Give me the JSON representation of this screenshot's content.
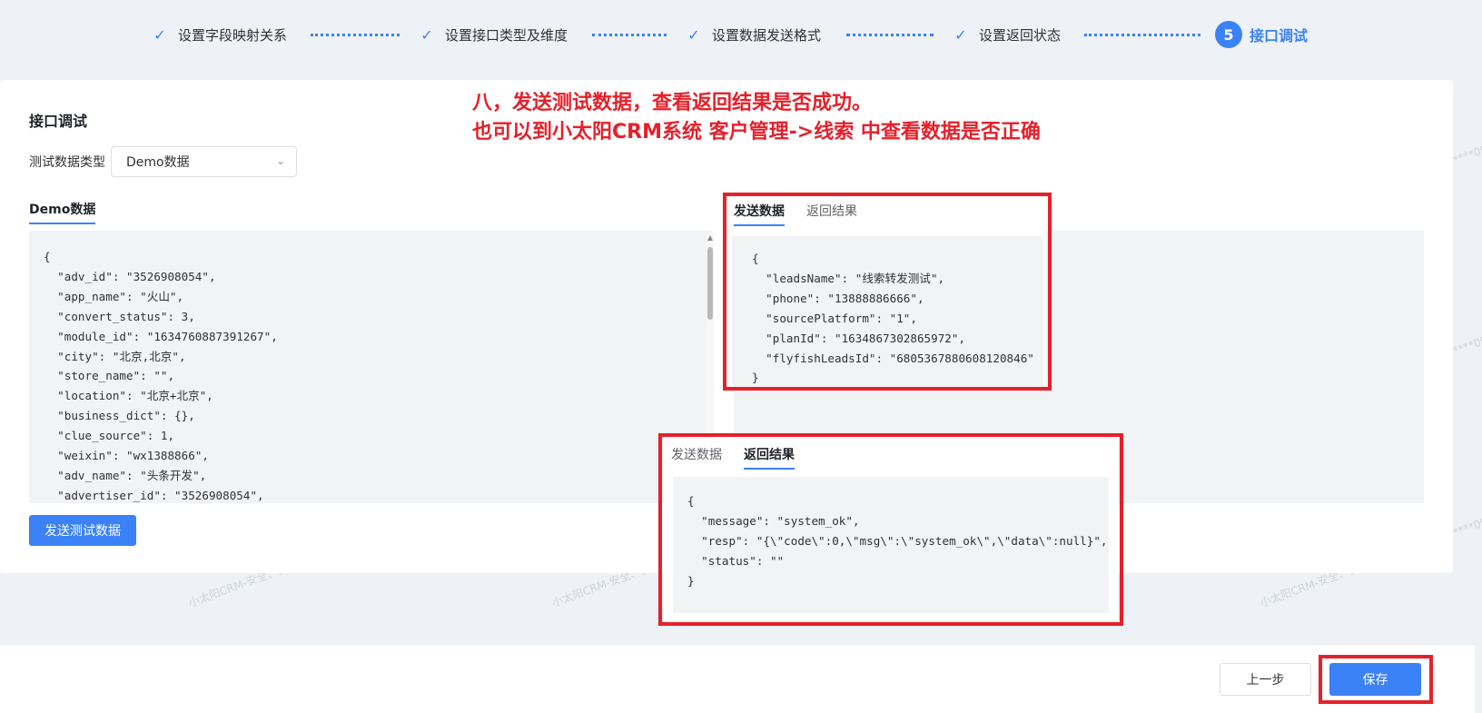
{
  "steps": [
    {
      "label": "设置字段映射关系",
      "done": true
    },
    {
      "label": "设置接口类型及维度",
      "done": true
    },
    {
      "label": "设置数据发送格式",
      "done": true
    },
    {
      "label": "设置返回状态",
      "done": true
    },
    {
      "number": "5",
      "label": "接口调试",
      "active": true
    }
  ],
  "card": {
    "title": "接口调试",
    "type_label": "测试数据类型",
    "type_value": "Demo数据",
    "demo_tab": "Demo数据",
    "send_button": "发送测试数据"
  },
  "demo_code": "{\n  \"adv_id\": \"3526908054\",\n  \"app_name\": \"火山\",\n  \"convert_status\": 3,\n  \"module_id\": \"1634760887391267\",\n  \"city\": \"北京,北京\",\n  \"store_name\": \"\",\n  \"location\": \"北京+北京\",\n  \"business_dict\": {},\n  \"clue_source\": 1,\n  \"weixin\": \"wx1388866\",\n  \"adv_name\": \"头条开发\",\n  \"advertiser_id\": \"3526908054\",",
  "annotation": {
    "line1": "八，发送测试数据，查看返回结果是否成功。",
    "line2": "也可以到小太阳CRM系统 客户管理->线索 中查看数据是否正确"
  },
  "send_panel": {
    "tab_send": "发送数据",
    "tab_result": "返回结果",
    "code": "{\n  \"leadsName\": \"线索转发测试\",\n  \"phone\": \"13888886666\",\n  \"sourcePlatform\": \"1\",\n  \"planId\": \"1634867302865972\",\n  \"flyfishLeadsId\": \"6805367880608120846\"\n}"
  },
  "result_panel": {
    "tab_send": "发送数据",
    "tab_result": "返回结果",
    "code": "{\n  \"message\": \"system_ok\",\n  \"resp\": \"{\\\"code\\\":0,\\\"msg\\\":\\\"system_ok\\\",\\\"data\\\":null}\",\n  \"status\": \"\"\n}"
  },
  "footer": {
    "prev_label": "上一步",
    "save_label": "保存"
  },
  "watermark": "小太阳CRM-安全、支持私有化部署 177******09",
  "colors": {
    "accent": "#3b82f6",
    "highlight": "#e6202a"
  }
}
